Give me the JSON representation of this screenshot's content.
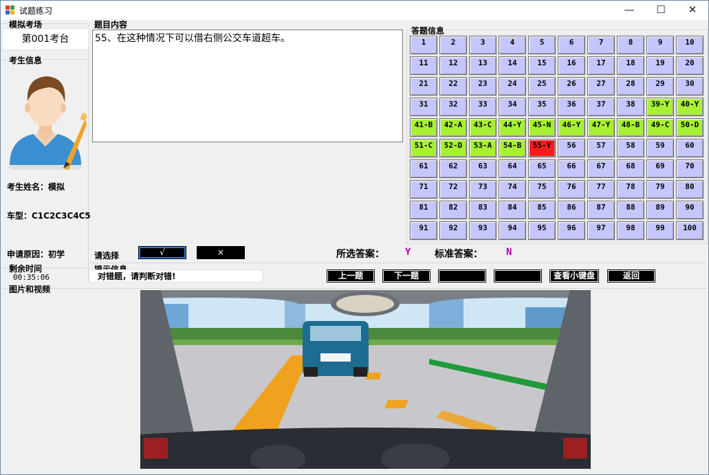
{
  "window": {
    "title": "试题练习",
    "minimize": "—",
    "maximize": "☐",
    "close": "✕"
  },
  "left": {
    "exam_room_title": "模拟考场",
    "exam_room_value": "第001考台",
    "examinee_title": "考生信息",
    "name_label": "考生姓名：模拟",
    "vehicle_label": "车型：C1C2C3C4C5",
    "reason_label": "申请原因：初学",
    "time_title": "剩余时间",
    "time_value": "00:35:06"
  },
  "question": {
    "title": "题目内容",
    "text": "55、在这种情况下可以借右侧公交车道超车。"
  },
  "answer_info": {
    "title": "答题信息",
    "cells": [
      "1",
      "2",
      "3",
      "4",
      "5",
      "6",
      "7",
      "8",
      "9",
      "10",
      "11",
      "12",
      "13",
      "14",
      "15",
      "16",
      "17",
      "18",
      "19",
      "20",
      "21",
      "22",
      "23",
      "24",
      "25",
      "26",
      "27",
      "28",
      "29",
      "30",
      "31",
      "32",
      "33",
      "34",
      "35",
      "36",
      "37",
      "38",
      "39-Y",
      "40-Y",
      "41-B",
      "42-A",
      "43-C",
      "44-Y",
      "45-N",
      "46-Y",
      "47-Y",
      "48-B",
      "49-C",
      "50-D",
      "51-C",
      "52-D",
      "53-A",
      "54-B",
      "55-Y",
      "56",
      "57",
      "58",
      "59",
      "60",
      "61",
      "62",
      "63",
      "64",
      "65",
      "66",
      "67",
      "68",
      "69",
      "70",
      "71",
      "72",
      "73",
      "74",
      "75",
      "76",
      "77",
      "78",
      "79",
      "80",
      "81",
      "82",
      "83",
      "84",
      "85",
      "86",
      "87",
      "88",
      "89",
      "90",
      "91",
      "92",
      "93",
      "94",
      "95",
      "96",
      "97",
      "98",
      "99",
      "100"
    ],
    "colors": {
      "unanswered": "#c6c6ff",
      "answered": "#a8f033",
      "current": "#ff1a1a"
    }
  },
  "select": {
    "label": "请选择",
    "true_btn": "√",
    "false_btn": "×",
    "selected_label": "所选答案：",
    "selected_value": "Y",
    "standard_label": "标准答案：",
    "standard_value": "N",
    "value_color": "#b000b0"
  },
  "hint": {
    "title": "提示信息",
    "text": "对错题，请判断对错!"
  },
  "nav": {
    "prev": "上一题",
    "next": "下一题",
    "blank1": "",
    "blank2": "",
    "keyboard": "查看小键盘",
    "back": "返回"
  },
  "media": {
    "title": "图片和视频"
  }
}
